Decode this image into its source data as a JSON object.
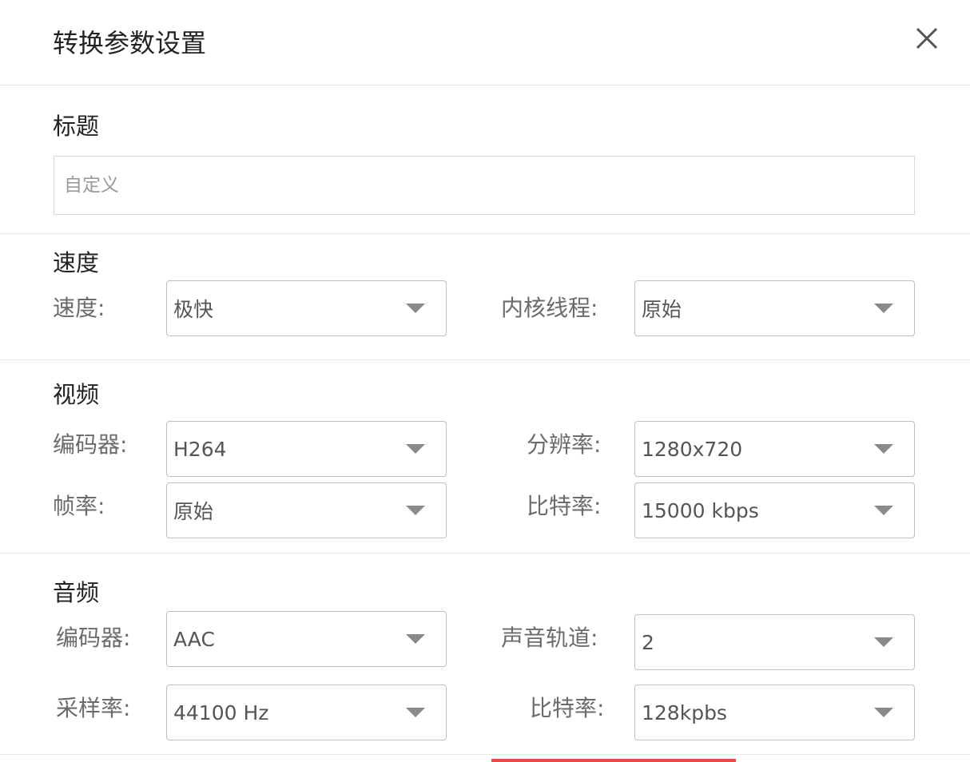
{
  "dialog": {
    "title": "转换参数设置"
  },
  "title_section": {
    "heading": "标题",
    "input_placeholder": "自定义",
    "input_value": ""
  },
  "speed_section": {
    "heading": "速度",
    "speed_label": "速度:",
    "speed_value": "极快",
    "threads_label": "内核线程:",
    "threads_value": "原始"
  },
  "video_section": {
    "heading": "视频",
    "encoder_label": "编码器:",
    "encoder_value": "H264",
    "resolution_label": "分辨率:",
    "resolution_value": "1280x720",
    "framerate_label": "帧率:",
    "framerate_value": "原始",
    "bitrate_label": "比特率:",
    "bitrate_value": "15000 kbps"
  },
  "audio_section": {
    "heading": "音频",
    "encoder_label": "编码器:",
    "encoder_value": "AAC",
    "channels_label": "声音轨道:",
    "channels_value": "2",
    "samplerate_label": "采样率:",
    "samplerate_value": "44100 Hz",
    "bitrate_label": "比特率:",
    "bitrate_value": "128kpbs"
  },
  "icons": {
    "close": "close-icon",
    "caret": "chevron-down-icon"
  },
  "colors": {
    "accent_bar": "#e94b4b",
    "border": "#bfbfbf"
  }
}
